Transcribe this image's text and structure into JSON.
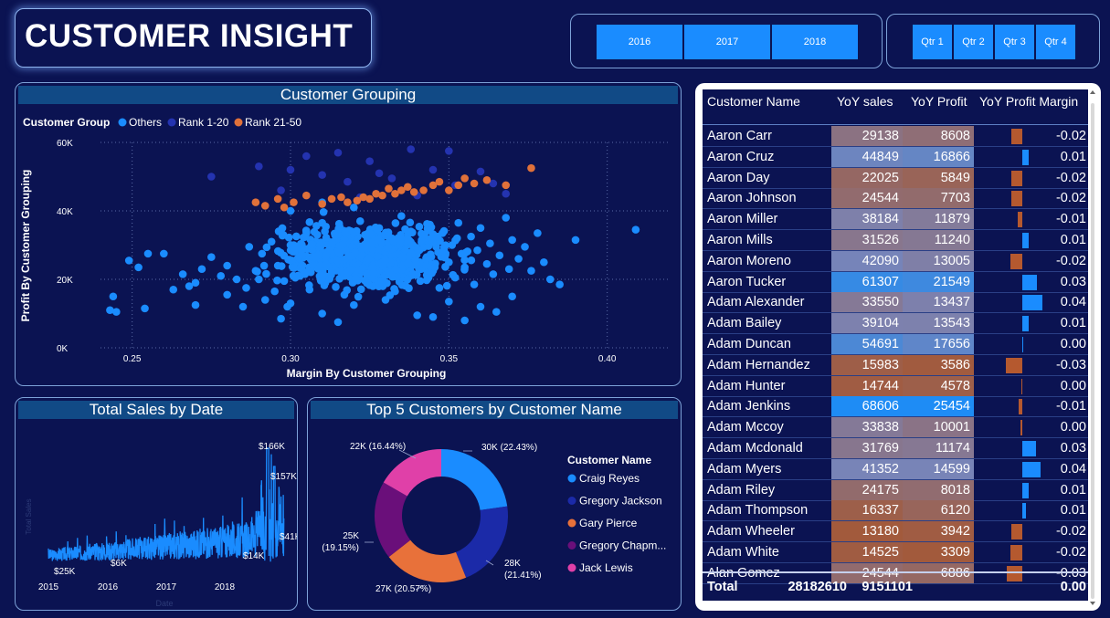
{
  "header": {
    "title": "CUSTOMER INSIGHT"
  },
  "slicers": {
    "years": [
      "2016",
      "2017",
      "2018"
    ],
    "quarters": [
      "Qtr 1",
      "Qtr 2",
      "Qtr 3",
      "Qtr 4"
    ]
  },
  "scatter": {
    "title": "Customer Grouping",
    "legend_title": "Customer Group",
    "colors": {
      "Others": "#1a8cff",
      "Rank 1-20": "#2433b0",
      "Rank 21-50": "#e0713a"
    },
    "chart_data": {
      "type": "scatter",
      "xlabel": "Margin By Customer Grouping",
      "ylabel": "Profit By Customer Grouping",
      "xlim": [
        0.24,
        0.42
      ],
      "ylim": [
        0,
        60000
      ],
      "xticks": [
        "0.25",
        "0.30",
        "0.35",
        "0.40"
      ],
      "yticks": [
        "0K",
        "20K",
        "40K",
        "60K"
      ],
      "series": [
        {
          "name": "Others",
          "points": [
            [
              0.244,
              15000
            ],
            [
              0.243,
              11000
            ],
            [
              0.245,
              10500
            ],
            [
              0.249,
              25500
            ],
            [
              0.252,
              23500
            ],
            [
              0.254,
              11500
            ],
            [
              0.255,
              27500
            ],
            [
              0.26,
              27500
            ],
            [
              0.263,
              17000
            ],
            [
              0.266,
              21500
            ],
            [
              0.268,
              18000
            ],
            [
              0.27,
              19000
            ],
            [
              0.272,
              23000
            ],
            [
              0.275,
              26500
            ],
            [
              0.278,
              21000
            ],
            [
              0.28,
              24000
            ],
            [
              0.283,
              20000
            ],
            [
              0.286,
              17500
            ],
            [
              0.289,
              22500
            ],
            [
              0.291,
              27500
            ],
            [
              0.292,
              14000
            ],
            [
              0.294,
              31000
            ],
            [
              0.296,
              24000
            ],
            [
              0.298,
              19500
            ],
            [
              0.299,
              12000
            ],
            [
              0.3,
              30000
            ],
            [
              0.302,
              25500
            ],
            [
              0.303,
              21000
            ],
            [
              0.305,
              34000
            ],
            [
              0.306,
              17000
            ],
            [
              0.308,
              28500
            ],
            [
              0.309,
              23000
            ],
            [
              0.31,
              36500
            ],
            [
              0.311,
              19000
            ],
            [
              0.313,
              26500
            ],
            [
              0.314,
              31000
            ],
            [
              0.316,
              22000
            ],
            [
              0.317,
              15500
            ],
            [
              0.318,
              33500
            ],
            [
              0.32,
              27000
            ],
            [
              0.321,
              20500
            ],
            [
              0.322,
              37000
            ],
            [
              0.323,
              24500
            ],
            [
              0.325,
              30500
            ],
            [
              0.326,
              18000
            ],
            [
              0.327,
              28000
            ],
            [
              0.328,
              35000
            ],
            [
              0.33,
              22500
            ],
            [
              0.331,
              25500
            ],
            [
              0.332,
              32000
            ],
            [
              0.333,
              16500
            ],
            [
              0.334,
              29000
            ],
            [
              0.335,
              38500
            ],
            [
              0.336,
              21000
            ],
            [
              0.337,
              27000
            ],
            [
              0.338,
              34000
            ],
            [
              0.34,
              24000
            ],
            [
              0.341,
              19500
            ],
            [
              0.342,
              31500
            ],
            [
              0.343,
              26500
            ],
            [
              0.344,
              36000
            ],
            [
              0.345,
              22500
            ],
            [
              0.346,
              29500
            ],
            [
              0.347,
              17500
            ],
            [
              0.348,
              33500
            ],
            [
              0.35,
              25000
            ],
            [
              0.351,
              30000
            ],
            [
              0.352,
              20500
            ],
            [
              0.353,
              36500
            ],
            [
              0.354,
              27500
            ],
            [
              0.355,
              23500
            ],
            [
              0.357,
              32500
            ],
            [
              0.358,
              18500
            ],
            [
              0.359,
              28500
            ],
            [
              0.36,
              35000
            ],
            [
              0.362,
              24500
            ],
            [
              0.363,
              30500
            ],
            [
              0.364,
              21500
            ],
            [
              0.366,
              27000
            ],
            [
              0.368,
              38000
            ],
            [
              0.369,
              23000
            ],
            [
              0.37,
              31500
            ],
            [
              0.372,
              26000
            ],
            [
              0.374,
              29500
            ],
            [
              0.376,
              22500
            ],
            [
              0.378,
              33500
            ],
            [
              0.38,
              25000
            ],
            [
              0.382,
              20000
            ],
            [
              0.385,
              18500
            ],
            [
              0.39,
              31500
            ],
            [
              0.409,
              34500
            ],
            [
              0.29,
              20000
            ],
            [
              0.295,
              16500
            ],
            [
              0.3,
              13000
            ],
            [
              0.31,
              10000
            ],
            [
              0.32,
              12500
            ],
            [
              0.33,
              14000
            ],
            [
              0.34,
              9500
            ],
            [
              0.35,
              13500
            ],
            [
              0.36,
              12000
            ],
            [
              0.37,
              15000
            ],
            [
              0.3,
              40000
            ],
            [
              0.31,
              42500
            ],
            [
              0.32,
              41000
            ],
            [
              0.285,
              12000
            ],
            [
              0.297,
              8500
            ],
            [
              0.315,
              7500
            ],
            [
              0.345,
              9000
            ],
            [
              0.355,
              8000
            ],
            [
              0.365,
              10500
            ],
            [
              0.28,
              15500
            ],
            [
              0.27,
              12500
            ]
          ]
        },
        {
          "name": "Rank 1-20",
          "points": [
            [
              0.275,
              50000
            ],
            [
              0.29,
              53000
            ],
            [
              0.297,
              46000
            ],
            [
              0.305,
              56000
            ],
            [
              0.31,
              50500
            ],
            [
              0.318,
              48500
            ],
            [
              0.325,
              54500
            ],
            [
              0.332,
              49500
            ],
            [
              0.338,
              58000
            ],
            [
              0.345,
              52000
            ],
            [
              0.352,
              47500
            ],
            [
              0.36,
              51500
            ],
            [
              0.368,
              45000
            ],
            [
              0.322,
              44000
            ],
            [
              0.35,
              57500
            ],
            [
              0.3,
              52000
            ],
            [
              0.315,
              57000
            ],
            [
              0.34,
              44500
            ],
            [
              0.364,
              48000
            ],
            [
              0.328,
              51000
            ]
          ]
        },
        {
          "name": "Rank 21-50",
          "points": [
            [
              0.289,
              42500
            ],
            [
              0.292,
              41500
            ],
            [
              0.296,
              43500
            ],
            [
              0.298,
              41000
            ],
            [
              0.301,
              42500
            ],
            [
              0.305,
              44500
            ],
            [
              0.31,
              42000
            ],
            [
              0.313,
              43500
            ],
            [
              0.316,
              44000
            ],
            [
              0.318,
              42500
            ],
            [
              0.321,
              43000
            ],
            [
              0.323,
              44000
            ],
            [
              0.325,
              43500
            ],
            [
              0.327,
              45000
            ],
            [
              0.329,
              44500
            ],
            [
              0.331,
              46500
            ],
            [
              0.333,
              45000
            ],
            [
              0.335,
              46000
            ],
            [
              0.337,
              47000
            ],
            [
              0.339,
              45500
            ],
            [
              0.342,
              46000
            ],
            [
              0.345,
              47500
            ],
            [
              0.347,
              48500
            ],
            [
              0.35,
              46000
            ],
            [
              0.353,
              47500
            ],
            [
              0.355,
              49500
            ],
            [
              0.358,
              48000
            ],
            [
              0.362,
              49000
            ],
            [
              0.368,
              47500
            ],
            [
              0.376,
              52500
            ]
          ]
        }
      ]
    }
  },
  "line": {
    "title": "Total Sales by Date",
    "color": "#1a8cff",
    "ylabel": "Total Sales",
    "xlabel": "Date",
    "chart_data": {
      "type": "line",
      "xticks": [
        "2015",
        "2016",
        "2017",
        "2018"
      ],
      "data_labels": [
        "$166K",
        "$157K",
        "$41K",
        "$25K",
        "$6K",
        "$14K"
      ],
      "note_values_in_dollars": [
        166000,
        157000,
        41000,
        25000,
        6000,
        14000
      ]
    }
  },
  "donut": {
    "title": "Top 5 Customers by Customer Name",
    "legend_title": "Customer Name",
    "chart_data": {
      "type": "pie",
      "categories": [
        "Craig Reyes",
        "Gregory Jackson",
        "Gary Pierce",
        "Gregory Chapm...",
        "Jack Lewis"
      ],
      "values": [
        30000,
        28000,
        27000,
        25000,
        22000
      ],
      "labels": [
        "30K (22.43%)",
        "28K (21.41%)",
        "27K (20.57%)",
        "25K (19.15%)",
        "22K (16.44%)"
      ],
      "colors": [
        "#1a8cff",
        "#1b2aa8",
        "#e8713a",
        "#6a0f7a",
        "#e040a8"
      ]
    }
  },
  "table": {
    "columns": [
      "Customer Name",
      "YoY sales",
      "YoY Profit",
      "YoY Profit Margin"
    ],
    "rows": [
      [
        "Aaron Carr",
        "29138",
        "8608",
        "-0.02"
      ],
      [
        "Aaron Cruz",
        "44849",
        "16866",
        "0.01"
      ],
      [
        "Aaron Day",
        "22025",
        "5849",
        "-0.02"
      ],
      [
        "Aaron Johnson",
        "24544",
        "7703",
        "-0.02"
      ],
      [
        "Aaron Miller",
        "38184",
        "11879",
        "-0.01"
      ],
      [
        "Aaron Mills",
        "31526",
        "11240",
        "0.01"
      ],
      [
        "Aaron Moreno",
        "42090",
        "13005",
        "-0.02"
      ],
      [
        "Aaron Tucker",
        "61307",
        "21549",
        "0.03"
      ],
      [
        "Adam Alexander",
        "33550",
        "13437",
        "0.04"
      ],
      [
        "Adam Bailey",
        "39104",
        "13543",
        "0.01"
      ],
      [
        "Adam Duncan",
        "54691",
        "17656",
        "0.00"
      ],
      [
        "Adam Hernandez",
        "15983",
        "3586",
        "-0.03"
      ],
      [
        "Adam Hunter",
        "14744",
        "4578",
        "0.00"
      ],
      [
        "Adam Jenkins",
        "68606",
        "25454",
        "-0.01"
      ],
      [
        "Adam Mccoy",
        "33838",
        "10001",
        "0.00"
      ],
      [
        "Adam Mcdonald",
        "31769",
        "11174",
        "0.03"
      ],
      [
        "Adam Myers",
        "41352",
        "14599",
        "0.04"
      ],
      [
        "Adam Riley",
        "24175",
        "8018",
        "0.01"
      ],
      [
        "Adam Thompson",
        "16337",
        "6120",
        "0.01"
      ],
      [
        "Adam Wheeler",
        "13180",
        "3942",
        "-0.02"
      ],
      [
        "Adam White",
        "14525",
        "3309",
        "-0.02"
      ],
      [
        "Alan Gomez",
        "24544",
        "6886",
        "-0.03"
      ]
    ],
    "margins_exact": [
      -0.021,
      0.012,
      -0.022,
      -0.021,
      -0.009,
      0.012,
      -0.024,
      0.028,
      0.039,
      0.012,
      0.001,
      -0.032,
      -0.002,
      -0.008,
      -0.003,
      0.027,
      0.036,
      0.012,
      0.007,
      -0.022,
      -0.024,
      -0.031
    ],
    "total": {
      "label": "Total",
      "sales": "28182610",
      "profit": "9151101",
      "margin": "0.00"
    },
    "colors": {
      "low": "#a25a3c",
      "mid": "#7a84b6",
      "high": "#1e8cf5",
      "pos_bar": "#1a8cff",
      "neg_bar": "#b5592f"
    }
  }
}
